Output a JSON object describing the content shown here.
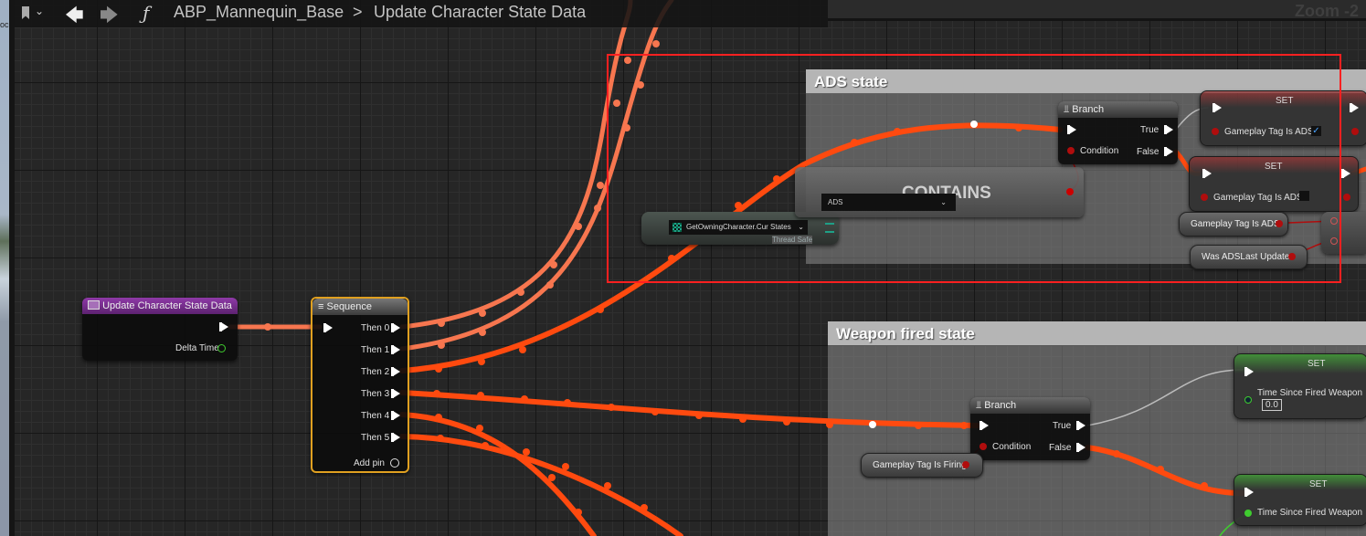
{
  "toolbar": {
    "bookmark_icon": "bookmark-icon",
    "back_icon": "arrow-left-icon",
    "forward_icon": "arrow-right-icon",
    "function_icon": "function-icon",
    "function_glyph": "ƒ",
    "breadcrumb": [
      "ABP_Mannequin_Base",
      "Update Character State Data"
    ],
    "breadcrumb_separator": ">"
  },
  "zoom_label": "Zoom -2",
  "left_strip_text": "oc",
  "comments": [
    {
      "title": "ADS state"
    },
    {
      "title": "Weapon fired state"
    }
  ],
  "nodes": {
    "entry": {
      "title": "Update Character State Data",
      "pin_delta": "Delta Time",
      "color": "#7a2d8f"
    },
    "sequence": {
      "title": "Sequence",
      "pins": [
        "Then 0",
        "Then 1",
        "Then 2",
        "Then 3",
        "Then 4",
        "Then 5"
      ],
      "add_pin": "Add pin",
      "border": "#e0a020"
    },
    "ads_branch": {
      "title": "Branch",
      "condition": "Condition",
      "true_label": "True",
      "false_label": "False"
    },
    "ads_set_true": {
      "title": "SET",
      "var": "Gameplay Tag Is ADS",
      "checked": true
    },
    "ads_set_false": {
      "title": "SET",
      "var": "Gameplay Tag Is ADS",
      "checked": false
    },
    "ads_get": {
      "label": "Gameplay Tag Is ADS"
    },
    "was_ads": {
      "label": "Was ADSLast Update"
    },
    "contains": {
      "title": "CONTAINS",
      "dropdown": "ADS"
    },
    "cur_states": {
      "label": "GetOwningCharacter.Cur States",
      "thread_safe": "Thread Safe"
    },
    "fired_branch": {
      "title": "Branch",
      "condition": "Condition",
      "true_label": "True",
      "false_label": "False"
    },
    "firing_get": {
      "label": "Gameplay Tag Is Firing"
    },
    "fired_set1": {
      "title": "SET",
      "var": "Time Since Fired Weapon",
      "value": "0.0"
    },
    "fired_set2": {
      "title": "SET",
      "var": "Time Since Fired Weapon"
    }
  },
  "colors": {
    "exec_wire": "#ff4a0f",
    "exec_wire_light": "#f7764f",
    "bool_pin": "#b00d0d",
    "float_pin": "#3fcc2f",
    "selection_box": "#ff2020"
  }
}
